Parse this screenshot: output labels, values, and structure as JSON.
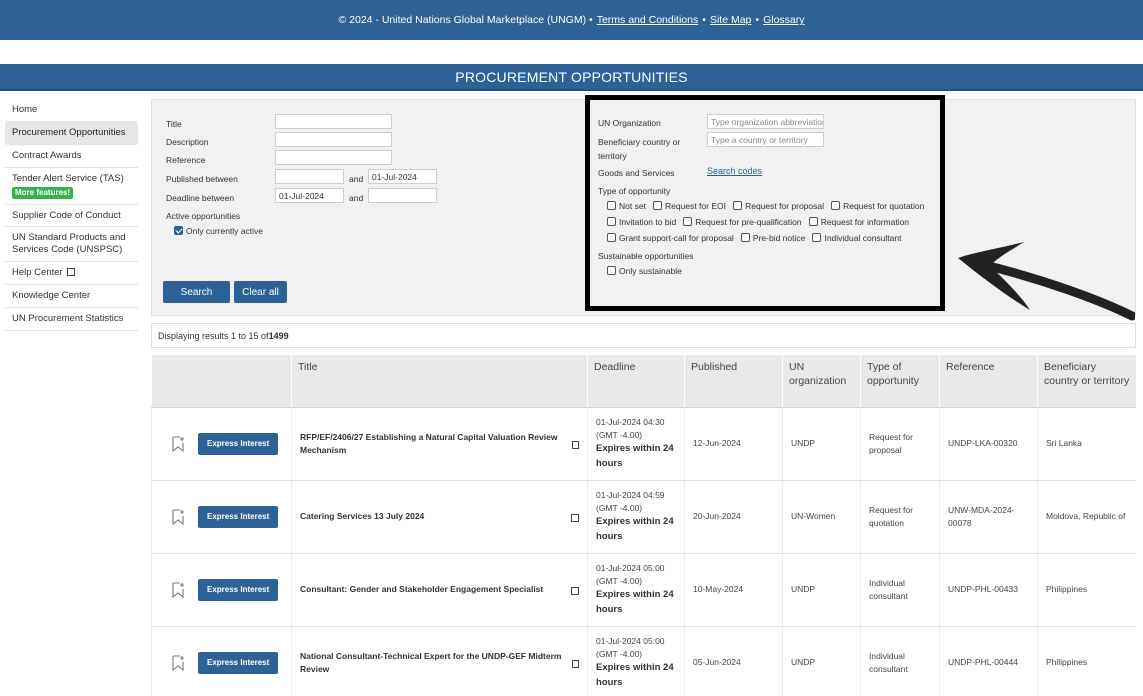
{
  "footer": {
    "copyright": "© 2024 - United Nations Global Marketplace (UNGM) •",
    "terms": "Terms and Conditions",
    "sep1": "•",
    "sitemap": "Site Map",
    "sep2": "•",
    "glossary": "Glossary"
  },
  "page_title": "PROCUREMENT OPPORTUNITIES",
  "sidebar": {
    "items": [
      {
        "label": "Home"
      },
      {
        "label": "Procurement Opportunities"
      },
      {
        "label": "Contract Awards"
      },
      {
        "label": "Tender Alert Service (TAS)",
        "badge": "More features!"
      },
      {
        "label": "Supplier Code of Conduct"
      },
      {
        "label": "UN Standard Products and Services Code (UNSPSC)"
      },
      {
        "label": "Help Center"
      },
      {
        "label": "Knowledge Center"
      },
      {
        "label": "UN Procurement Statistics"
      }
    ]
  },
  "filters": {
    "title_label": "Title",
    "description_label": "Description",
    "reference_label": "Reference",
    "published_label": "Published between",
    "published_and": "and",
    "published_to": "01-Jul-2024",
    "deadline_label": "Deadline between",
    "deadline_from": "01-Jul-2024",
    "deadline_and": "and",
    "active_label": "Active opportunities",
    "only_active": "Only currently active",
    "search_btn": "Search",
    "clear_btn": "Clear all",
    "un_org_label": "UN Organization",
    "un_org_placeholder": "Type organization abbreviation",
    "beneficiary_label_1": "Beneficiary country or",
    "beneficiary_label_2": "territory",
    "beneficiary_placeholder": "Type a country or territory",
    "goods_label": "Goods and Services",
    "search_codes": "Search codes",
    "type_label": "Type of opportunity",
    "types_row1": [
      "Not set",
      "Request for EOI",
      "Request for proposal",
      "Request for quotation"
    ],
    "types_row2": [
      "Invitation to bid",
      "Request for pre-qualification",
      "Request for information"
    ],
    "types_row3": [
      "Grant support-call for proposal",
      "Pre-bid notice",
      "Individual consultant"
    ],
    "sustainable_label": "Sustainable opportunities",
    "only_sustainable": "Only sustainable"
  },
  "results": {
    "prefix": "Displaying results 1 to 15 of ",
    "total": "1499"
  },
  "table": {
    "headers": [
      "Title",
      "Deadline",
      "Published",
      "UN organization",
      "Type of opportunity",
      "Reference",
      "Beneficiary country or territory"
    ],
    "express_label": "Express Interest",
    "rows": [
      {
        "title": "RFP/EF/2406/27 Establishing a Natural Capital Valuation Review Mechanism",
        "deadline": "01-Jul-2024 04:30",
        "tz": "(GMT -4.00)",
        "expires": "Expires within 24 hours",
        "published": "12-Jun-2024",
        "org": "UNDP",
        "type": "Request for proposal",
        "reference": "UNDP-LKA-00320",
        "country": "Sri Lanka"
      },
      {
        "title": "Catering Services 13 July 2024",
        "deadline": "01-Jul-2024 04:59",
        "tz": "(GMT -4.00)",
        "expires": "Expires within 24 hours",
        "published": "20-Jun-2024",
        "org": "UN-Women",
        "type": "Request for quotation",
        "reference": "UNW-MDA-2024-00078",
        "country": "Moldova, Republic of"
      },
      {
        "title": "Consultant: Gender and Stakeholder Engagement Specialist",
        "deadline": "01-Jul-2024 05:00",
        "tz": "(GMT -4.00)",
        "expires": "Expires within 24 hours",
        "published": "10-May-2024",
        "org": "UNDP",
        "type": "Individual consultant",
        "reference": "UNDP-PHL-00433",
        "country": "Philippines"
      },
      {
        "title": "National Consultant-Technical Expert for the UNDP-GEF Midterm Review",
        "deadline": "01-Jul-2024 05:00",
        "tz": "(GMT -4.00)",
        "expires": "Expires within 24 hours",
        "published": "05-Jun-2024",
        "org": "UNDP",
        "type": "Individual consultant",
        "reference": "UNDP-PHL-00444",
        "country": "Philippines"
      }
    ]
  },
  "colors": {
    "brand": "#2d6296",
    "badge": "#37b24d",
    "highlight": "#000000"
  }
}
